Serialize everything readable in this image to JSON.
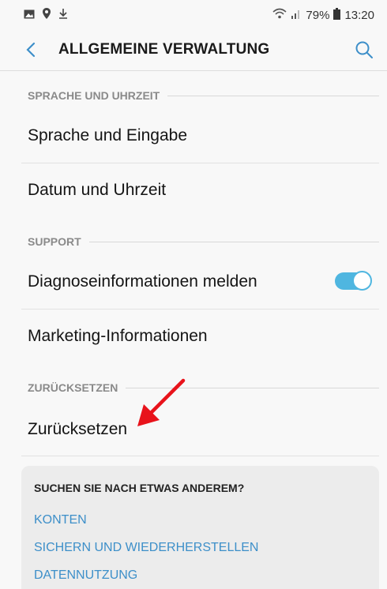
{
  "status_bar": {
    "battery_percent": "79%",
    "time": "13:20",
    "icons": [
      "image-icon",
      "location-icon",
      "download-icon",
      "wifi-icon",
      "signal-icon",
      "battery-icon"
    ]
  },
  "app_bar": {
    "title": "ALLGEMEINE VERWALTUNG",
    "back_icon": "chevron-left-icon",
    "search_icon": "search-icon",
    "accent_color": "#3d8fc9"
  },
  "sections": [
    {
      "header": "SPRACHE UND UHRZEIT",
      "items": [
        {
          "label": "Sprache und Eingabe"
        },
        {
          "label": "Datum und Uhrzeit"
        }
      ]
    },
    {
      "header": "SUPPORT",
      "items": [
        {
          "label": "Diagnoseinformationen melden",
          "toggle": true,
          "toggle_on": true
        },
        {
          "label": "Marketing-Informationen"
        }
      ]
    },
    {
      "header": "ZURÜCKSETZEN",
      "items": [
        {
          "label": "Zurücksetzen"
        }
      ]
    }
  ],
  "annotation": {
    "type": "red-arrow",
    "color": "#e8131b",
    "points_to": "Zurücksetzen"
  },
  "suggestion_card": {
    "title": "SUCHEN SIE NACH ETWAS ANDEREM?",
    "links": [
      "KONTEN",
      "SICHERN UND WIEDERHERSTELLEN",
      "DATENNUTZUNG"
    ]
  }
}
